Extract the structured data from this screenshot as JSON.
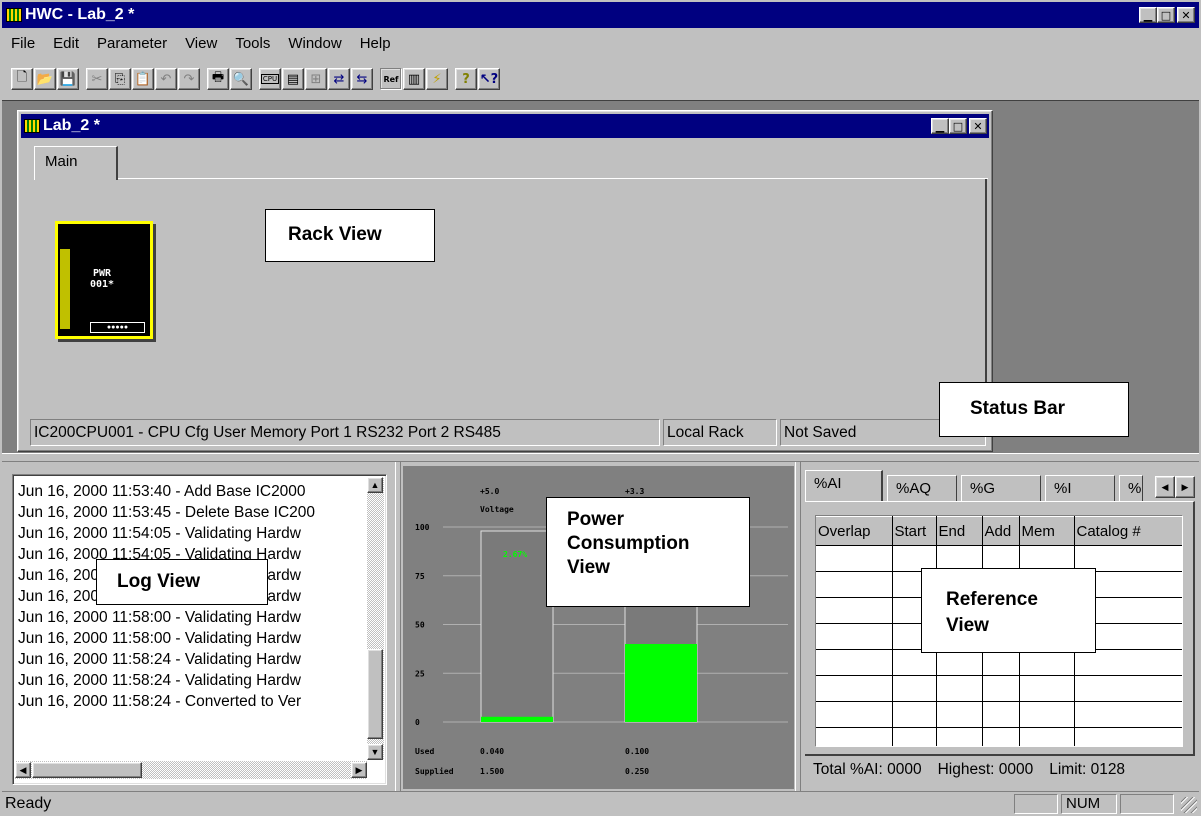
{
  "app": {
    "title": "HWC - Lab_2 *"
  },
  "menu": [
    "File",
    "Edit",
    "Parameter",
    "View",
    "Tools",
    "Window",
    "Help"
  ],
  "toolbar": {
    "groups": [
      [
        "new-icon",
        "open-icon",
        "save-icon"
      ],
      [
        "cut-icon",
        "copy-icon",
        "paste-icon",
        "undo-icon",
        "redo-icon"
      ],
      [
        "print-icon",
        "print-preview-icon"
      ],
      [
        "cpu-icon",
        "config-icon",
        "module-add-icon",
        "rack-icon",
        "rack-replace-icon"
      ],
      [
        "reference-icon",
        "report-icon",
        "power-icon"
      ],
      [
        "help-icon",
        "context-help-icon"
      ]
    ],
    "ref_label": "Ref",
    "cpu_label": "CPU"
  },
  "child": {
    "title": "Lab_2 *",
    "tab": "Main",
    "module": {
      "line1": "PWR",
      "line2": "001*"
    },
    "status": {
      "info": "IC200CPU001 - CPU Cfg User Memory Port 1 RS232 Port 2 RS485",
      "rack": "Local Rack",
      "saved": "Not Saved"
    }
  },
  "annotations": {
    "rack_view": "Rack View",
    "status_bar": "Status Bar",
    "log_view": "Log View",
    "power_view_1": "Power",
    "power_view_2": "Consumption",
    "power_view_3": "View",
    "reference_view_1": "Reference",
    "reference_view_2": "View"
  },
  "log": {
    "entries": [
      "Jun 16, 2000 11:53:40 - Add Base IC2000",
      "Jun 16, 2000 11:53:45 - Delete Base IC200",
      "Jun 16, 2000 11:54:05 - Validating Hardw",
      "Jun 16, 2000 11:54:05 - Validating Hardw",
      "Jun 16, 2000 11:54:05 - Validating Hardw",
      "Jun 16, 2000 11:54:20 - Validating Hardw",
      "Jun 16, 2000 11:58:00 - Validating Hardw",
      "Jun 16, 2000 11:58:00 - Validating Hardw",
      "Jun 16, 2000 11:58:24 - Validating Hardw",
      "Jun 16, 2000 11:58:24 - Validating Hardw",
      "Jun 16, 2000 11:58:24 - Converted to Ver"
    ]
  },
  "power": {
    "series_labels": [
      "+5.0",
      "+3.3"
    ],
    "voltage_label": "Voltage",
    "percent_label": "2.67%",
    "used_label": "Used",
    "supplied_label": "Supplied",
    "used": [
      "0.040",
      "0.100"
    ],
    "supplied": [
      "1.500",
      "0.250"
    ]
  },
  "chart_data": {
    "type": "bar",
    "categories": [
      "+5.0",
      "+3.3"
    ],
    "series": [
      {
        "name": "Used",
        "values": [
          2.67,
          40
        ]
      }
    ],
    "yticks": [
      "100",
      "75",
      "50",
      "25",
      "0"
    ],
    "ylim": [
      0,
      100
    ],
    "bar_label": "2.67%"
  },
  "reference": {
    "tabs": [
      "%AI",
      "%AQ",
      "%G",
      "%I",
      "%"
    ],
    "columns": [
      "Overlap",
      "Start",
      "End",
      "Add",
      "Mem",
      "Catalog #"
    ],
    "rows": 8,
    "footer": {
      "total": "Total %AI: 0000",
      "highest": "Highest: 0000",
      "limit": "Limit: 0128"
    }
  },
  "statusbar": {
    "text": "Ready",
    "num": "NUM"
  },
  "colors": {
    "titlebar": "#000080",
    "used_bar": "#00ff00",
    "module_border": "#ffff00"
  }
}
